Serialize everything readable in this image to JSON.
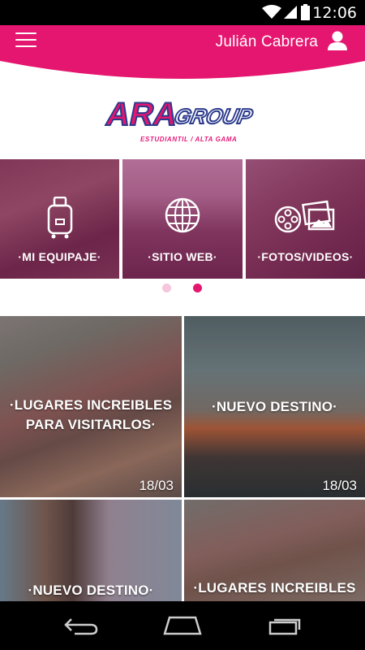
{
  "status_bar": {
    "time": "12:06",
    "icons": [
      "wifi-icon",
      "signal-icon",
      "battery-icon"
    ]
  },
  "header": {
    "menu_icon": "hamburger-menu-icon",
    "user_name": "Julián Cabrera",
    "user_icon": "user-avatar-icon",
    "brand_color": "#e5166f"
  },
  "logo": {
    "text_main": "ARA",
    "text_secondary": "GROUP",
    "tagline": "ESTUDIANTIL  /  ALTA GAMA"
  },
  "carousel": {
    "tiles": [
      {
        "label": "·MI EQUIPAJE·",
        "icon": "luggage-icon"
      },
      {
        "label": "·SITIO WEB·",
        "icon": "globe-icon"
      },
      {
        "label": "·FOTOS/VIDEOS·",
        "icon": "photos-videos-icon"
      }
    ],
    "page_count": 2,
    "active_page": 2
  },
  "cards": [
    {
      "title_line1": "·LUGARES INCREIBLES",
      "title_line2": "PARA VISITARLOS·",
      "date": "18/03"
    },
    {
      "title_line1": "·NUEVO DESTINO·",
      "title_line2": "",
      "date": "18/03"
    },
    {
      "title_line1": "·NUEVO DESTINO·",
      "title_line2": "",
      "date": ""
    },
    {
      "title_line1": "·LUGARES INCREIBLES",
      "title_line2": "",
      "date": ""
    }
  ],
  "nav_bar": {
    "buttons": [
      "back-icon",
      "home-icon",
      "recent-apps-icon"
    ]
  }
}
